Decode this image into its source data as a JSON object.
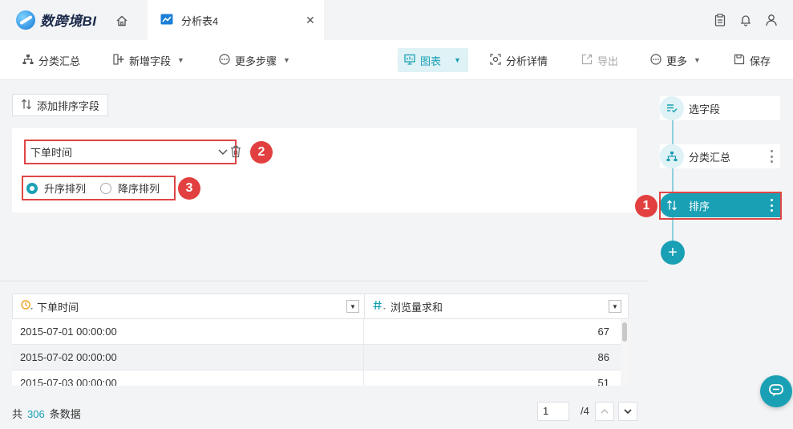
{
  "app": {
    "logo_text": "数跨境BI"
  },
  "tabs": [
    {
      "label": "分析表4"
    }
  ],
  "toolbar": {
    "group_summary": "分类汇总",
    "add_field": "新增字段",
    "more_steps": "更多步骤",
    "chart": "图表",
    "analysis_detail": "分析详情",
    "export": "导出",
    "more": "更多",
    "save": "保存"
  },
  "sort": {
    "add_button": "添加排序字段",
    "field": "下单时间",
    "ascending": "升序排列",
    "descending": "降序排列",
    "selected": "ascending"
  },
  "badges": {
    "b1": "1",
    "b2": "2",
    "b3": "3"
  },
  "table": {
    "columns": [
      {
        "label": "下单时间",
        "type_icon": "clock-icon"
      },
      {
        "label": "浏览量求和",
        "type_icon": "hash-icon"
      }
    ],
    "rows": [
      {
        "time": "2015-07-01 00:00:00",
        "value": "67"
      },
      {
        "time": "2015-07-02 00:00:00",
        "value": "86"
      },
      {
        "time": "2015-07-03 00:00:00",
        "value": "51"
      }
    ]
  },
  "footer": {
    "total_prefix": "共",
    "total_count": "306",
    "total_suffix": "条数据",
    "page_current": "1",
    "page_total": "/4"
  },
  "flow": {
    "steps": [
      {
        "label": "选字段"
      },
      {
        "label": "分类汇总"
      },
      {
        "label": "排序"
      }
    ]
  },
  "colors": {
    "accent": "#1aa0b4",
    "highlight": "#e04545"
  }
}
